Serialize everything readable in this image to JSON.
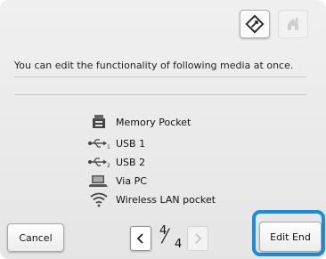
{
  "top_buttons": [
    {
      "icon": "edit-media-icon",
      "state": "active"
    },
    {
      "icon": "home-icon",
      "state": "disabled"
    }
  ],
  "message": "You can edit the functionality of following media at once.",
  "media": [
    {
      "icon": "memory-pocket-icon",
      "label": "Memory Pocket"
    },
    {
      "icon": "usb-1-icon",
      "label": "USB 1"
    },
    {
      "icon": "usb-2-icon",
      "label": "USB 2"
    },
    {
      "icon": "computer-icon",
      "label": "Via PC"
    },
    {
      "icon": "wireless-lan-icon",
      "label": "Wireless LAN pocket"
    }
  ],
  "footer": {
    "cancel_label": "Cancel",
    "edit_end_label": "Edit End",
    "page_current": "4",
    "page_total": "4"
  },
  "colors": {
    "highlight": "#1a8dd8",
    "panel": "#ececec"
  }
}
